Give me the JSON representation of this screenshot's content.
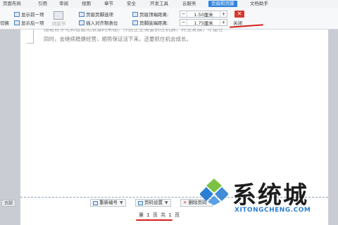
{
  "menu": {
    "tabs": [
      "页面布局",
      "引用",
      "审阅",
      "视图",
      "章节",
      "安全",
      "开发工具",
      "云服务",
      "页眉和页脚",
      "文档助手"
    ],
    "active_tab": "页眉和页脚"
  },
  "ribbon": {
    "toggle_label": "切换",
    "show_prev": "显示前一项",
    "show_next": "显示后一项",
    "same_as_prev": "同前节",
    "header_footer_options": "页眉页脚选项",
    "insert_align_tab": "插入对齐制表位",
    "header_top_distance_label": "页眉顶端距离:",
    "footer_bottom_distance_label": "页脚底端距离:",
    "header_top_distance_value": "1.50厘米",
    "footer_bottom_distance_value": "1.75厘米",
    "spin_minus": "−",
    "spin_plus": "+",
    "close_label": "关闭"
  },
  "document": {
    "body_line_top": "随着数字化和智能化浪潮的来临，传统企业需要抓住机遇，转型发展，才能在",
    "body_line_2": "同时，会继续稳健经营，顺势保证活下来，还要抓住机会成长。"
  },
  "footer": {
    "tag": "页脚",
    "renumber": "重新编号",
    "page_number_settings": "页码设置",
    "delete_page_number": "删除页码",
    "page_number_text": "第 1 页 共 1 页"
  },
  "watermark": {
    "title": "系统城",
    "subtitle": "XITONGCHENG.COM"
  },
  "colors": {
    "accent": "#2f84e0",
    "close_red": "#d6382c",
    "underline_red": "#d6201a",
    "watermark_blue": "#2b7fd3",
    "watermark_green": "#7cc242"
  }
}
